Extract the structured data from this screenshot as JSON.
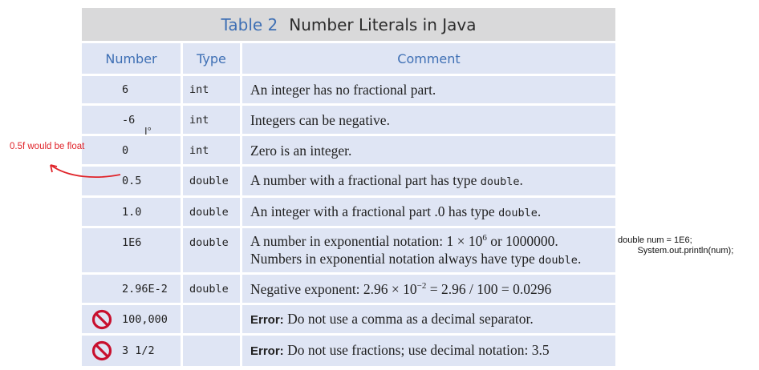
{
  "table": {
    "title_number": "Table 2",
    "title_text": "Number Literals in Java",
    "headers": {
      "number": "Number",
      "type": "Type",
      "comment": "Comment"
    },
    "rows": [
      {
        "number": "6",
        "type": "int",
        "comment": [
          {
            "t": "An integer has no fractional part."
          }
        ]
      },
      {
        "number": "-6",
        "type": "int",
        "comment": [
          {
            "t": "Integers can be negative."
          }
        ]
      },
      {
        "number": "0",
        "type": "int",
        "comment": [
          {
            "t": "Zero is an integer."
          }
        ]
      },
      {
        "number": "0.5",
        "type": "double",
        "comment": [
          {
            "t": "A number with a fractional part has type "
          },
          {
            "t": "double",
            "code": true
          },
          {
            "t": "."
          }
        ]
      },
      {
        "number": "1.0",
        "type": "double",
        "comment": [
          {
            "t": "An integer with a fractional part "
          },
          {
            "t": ".0"
          },
          {
            "t": " has type "
          },
          {
            "t": "double",
            "code": true
          },
          {
            "t": "."
          }
        ]
      },
      {
        "number": "1E6",
        "type": "double",
        "comment": [
          {
            "t": "A number in exponential notation: 1 × 10"
          },
          {
            "t": "6",
            "sup": true
          },
          {
            "t": " or 1000000."
          },
          {
            "br": true
          },
          {
            "t": "Numbers in exponential notation always have type "
          },
          {
            "t": "double",
            "code": true
          },
          {
            "t": "."
          }
        ]
      },
      {
        "number": "2.96E-2",
        "type": "double",
        "comment": [
          {
            "t": "Negative exponent: 2.96 × 10"
          },
          {
            "t": "−2",
            "sup": true
          },
          {
            "t": " = 2.96 / 100 = 0.0296"
          }
        ]
      },
      {
        "number": "100,000",
        "type": "",
        "error": true,
        "comment": [
          {
            "t": "Error:",
            "bold": true
          },
          {
            "t": " Do not use a comma as a decimal separator."
          }
        ]
      },
      {
        "number": "3 1/2",
        "type": "",
        "error": true,
        "comment": [
          {
            "t": "Error:",
            "bold": true
          },
          {
            "t": " Do not use fractions; use decimal notation: 3.5"
          }
        ]
      }
    ]
  },
  "annotations": {
    "left_note": "0.5f would be float",
    "right_note_line1": "double num = 1E6;",
    "right_note_line2": "System.out.println(num);"
  },
  "colors": {
    "cell_bg": "#dfe5f4",
    "title_bg": "#d9d9da",
    "header_blue": "#3e6fb4",
    "annotation_red": "#e0242a",
    "error_icon": "#c8102e"
  }
}
